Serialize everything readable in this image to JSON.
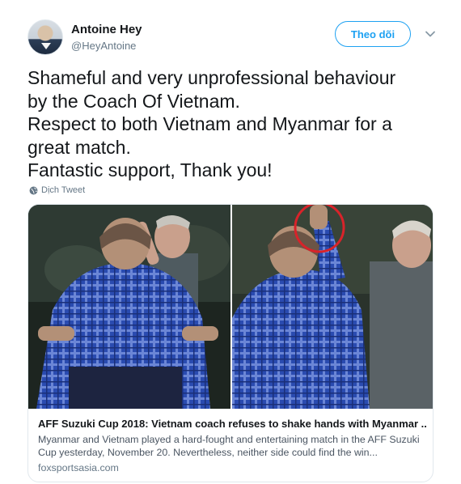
{
  "author": {
    "name": "Antoine Hey",
    "handle": "@HeyAntoine"
  },
  "header": {
    "follow_label": "Theo dõi",
    "more_icon": "chevron-down-icon"
  },
  "tweet": {
    "text": "Shameful and very unprofessional  behaviour\nby the Coach Of Vietnam.\nRespect to both Vietnam and Myanmar for a\ngreat match.\nFantastic support, Thank you!",
    "translate_label": "Dịch Tweet",
    "translate_icon": "globe-icon"
  },
  "card": {
    "title": "AFF Suzuki Cup 2018: Vietnam coach refuses to shake hands with Myanmar ...",
    "description": "Myanmar and Vietnam played a hard-fought and entertaining match in the AFF Suzuki Cup yesterday, November 20. Nevertheless, neither side could find the win...",
    "domain": "foxsportsasia.com"
  },
  "colors": {
    "accent": "#1da1f2",
    "text": "#14171a",
    "secondary": "#657786",
    "highlight_circle": "#d8232a"
  }
}
